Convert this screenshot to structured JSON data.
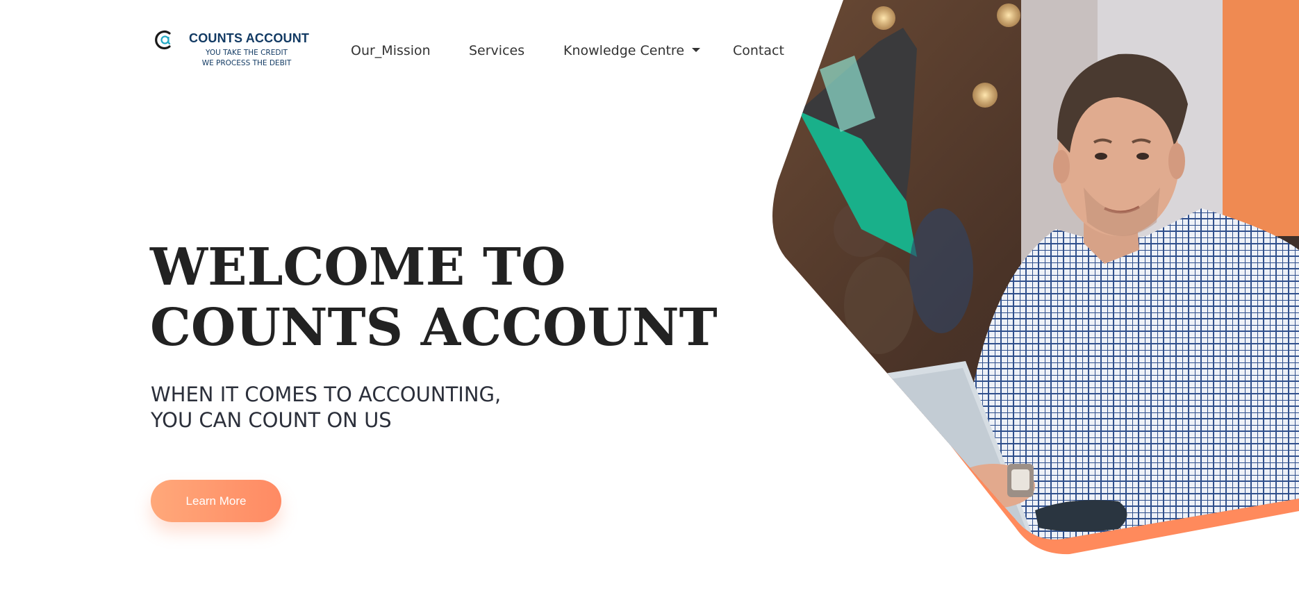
{
  "brand": {
    "name": "COUNTS ACCOUNT",
    "tagline_1": "YOU TAKE THE CREDIT",
    "tagline_2": "WE PROCESS THE DEBIT",
    "logo_icon": "at-sign-logo-icon",
    "color": "#123a63"
  },
  "nav": {
    "items": [
      {
        "label": "Our_Mission"
      },
      {
        "label": "Services"
      },
      {
        "label": "Knowledge Centre",
        "icon": "caret-down-icon"
      },
      {
        "label": "Contact"
      }
    ]
  },
  "hero": {
    "title_line1": "WELCOME TO",
    "title_line2": "COUNTS ACCOUNT",
    "subtitle_line1": "WHEN IT COMES TO ACCOUNTING,",
    "subtitle_line2": "YOU CAN COUNT ON US",
    "cta_label": "Learn More",
    "accent_color": "#ff8a63",
    "image_description": "hero-photo-man-with-laptop"
  }
}
